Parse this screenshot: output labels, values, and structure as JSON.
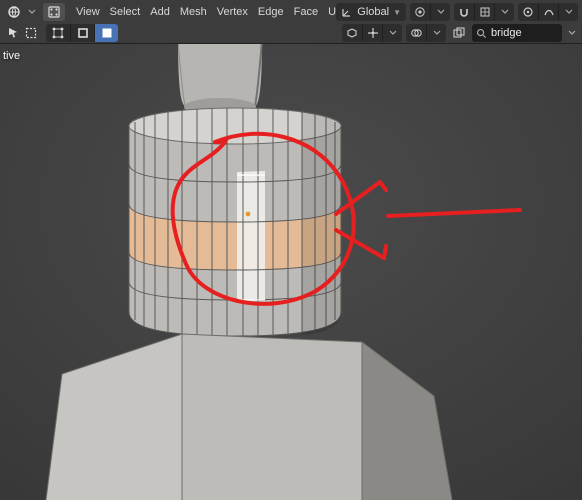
{
  "header": {
    "top_menus": [
      "View",
      "Select",
      "Add",
      "Mesh",
      "Vertex",
      "Edge",
      "Face",
      "UV"
    ],
    "orientation": {
      "label": "Global"
    },
    "select_modes": [
      {
        "name": "vertex",
        "active": false
      },
      {
        "name": "edge",
        "active": false
      },
      {
        "name": "face",
        "active": true
      }
    ],
    "search": {
      "value": "bridge"
    }
  },
  "overlay": {
    "mode_suffix": "tive"
  },
  "colors": {
    "bg": "#3f3f3f",
    "face_base": "#b7b6b4",
    "face_shadow": "#9b9a98",
    "face_light": "#cfceca",
    "edge": "#4a4a4a",
    "selected_face": "#e6b98f",
    "selected_edge": "#ffffff",
    "cursor_center": "#e59a2e",
    "annotation": "#e62020"
  }
}
